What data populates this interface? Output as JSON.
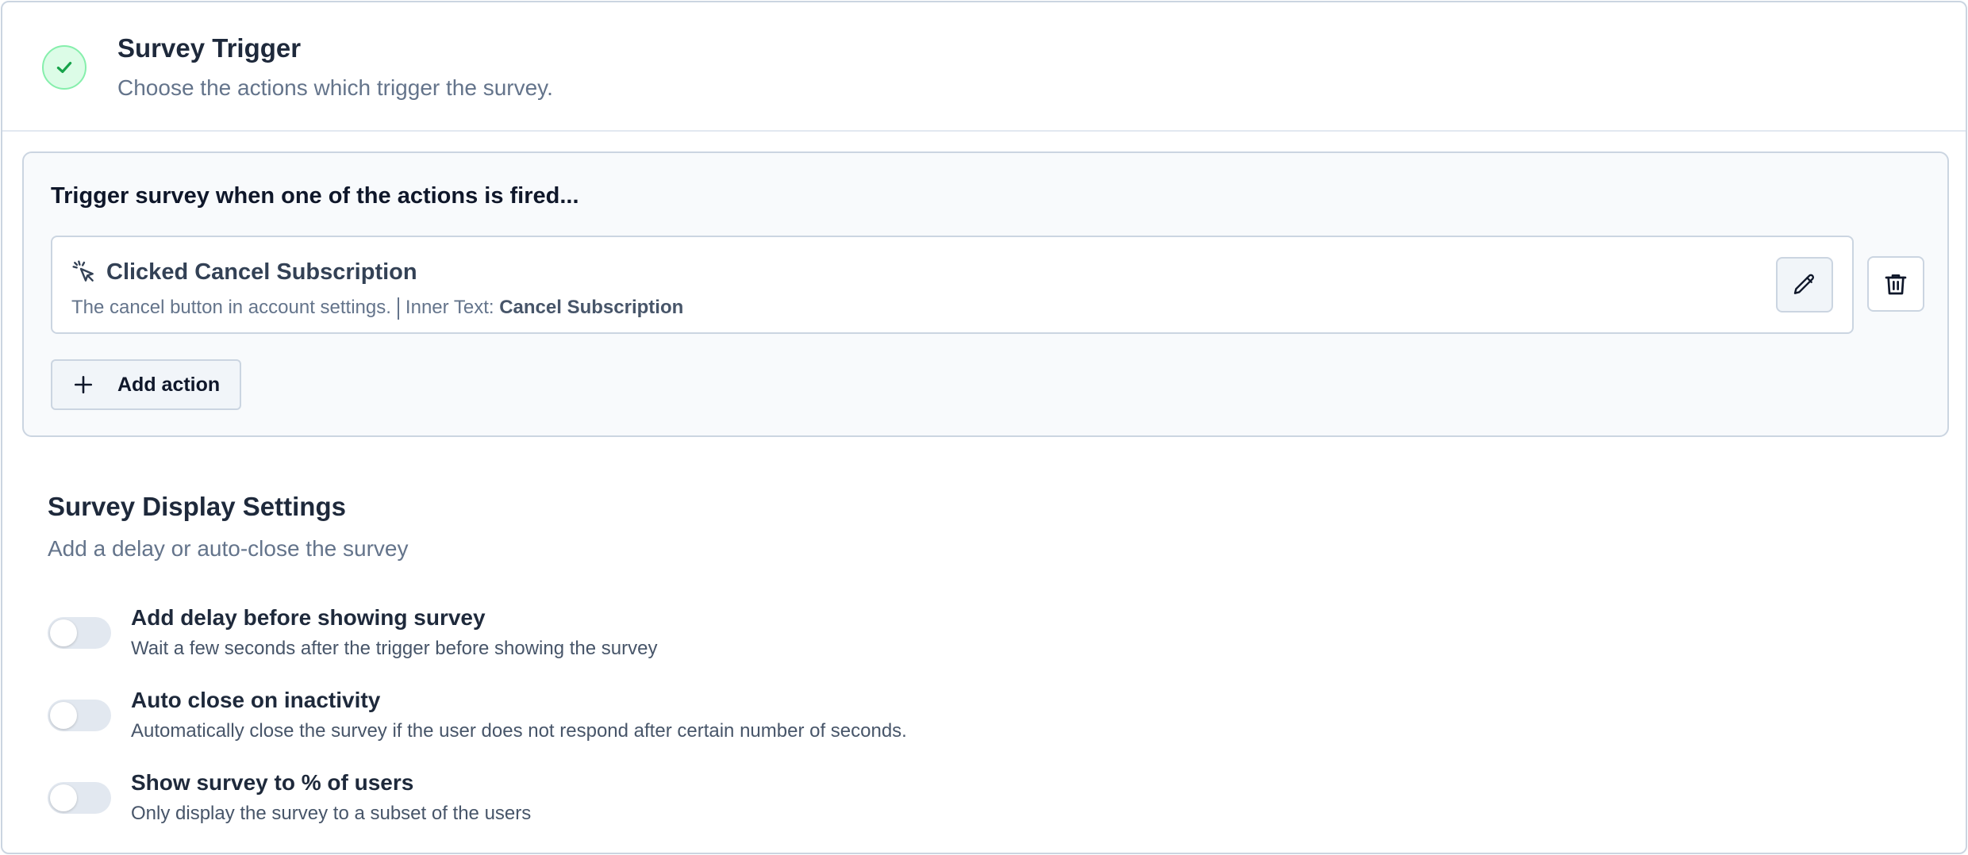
{
  "header": {
    "title": "Survey Trigger",
    "description": "Choose the actions which trigger the survey."
  },
  "trigger": {
    "heading": "Trigger survey when one of the actions is fired...",
    "actions": [
      {
        "title": "Clicked Cancel Subscription",
        "description": "The cancel button in account settings.",
        "inner_text_label": "Inner Text:",
        "inner_text_value": "Cancel Subscription"
      }
    ],
    "add_action_label": "Add action"
  },
  "display_settings": {
    "title": "Survey Display Settings",
    "description": "Add a delay or auto-close the survey",
    "toggles": [
      {
        "label": "Add delay before showing survey",
        "description": "Wait a few seconds after the trigger before showing the survey",
        "enabled": false
      },
      {
        "label": "Auto close on inactivity",
        "description": "Automatically close the survey if the user does not respond after certain number of seconds.",
        "enabled": false
      },
      {
        "label": "Show survey to % of users",
        "description": "Only display the survey to a subset of the users",
        "enabled": false
      }
    ]
  },
  "icons": {
    "header": "check-icon",
    "action": "cursor-click-icon",
    "edit": "pencil-icon",
    "delete": "trash-icon",
    "add": "plus-icon"
  },
  "colors": {
    "success_bg": "#dcfce7",
    "success_border": "#86efac",
    "success_check": "#16a34a",
    "toggle_off": "#e2e8f0"
  }
}
